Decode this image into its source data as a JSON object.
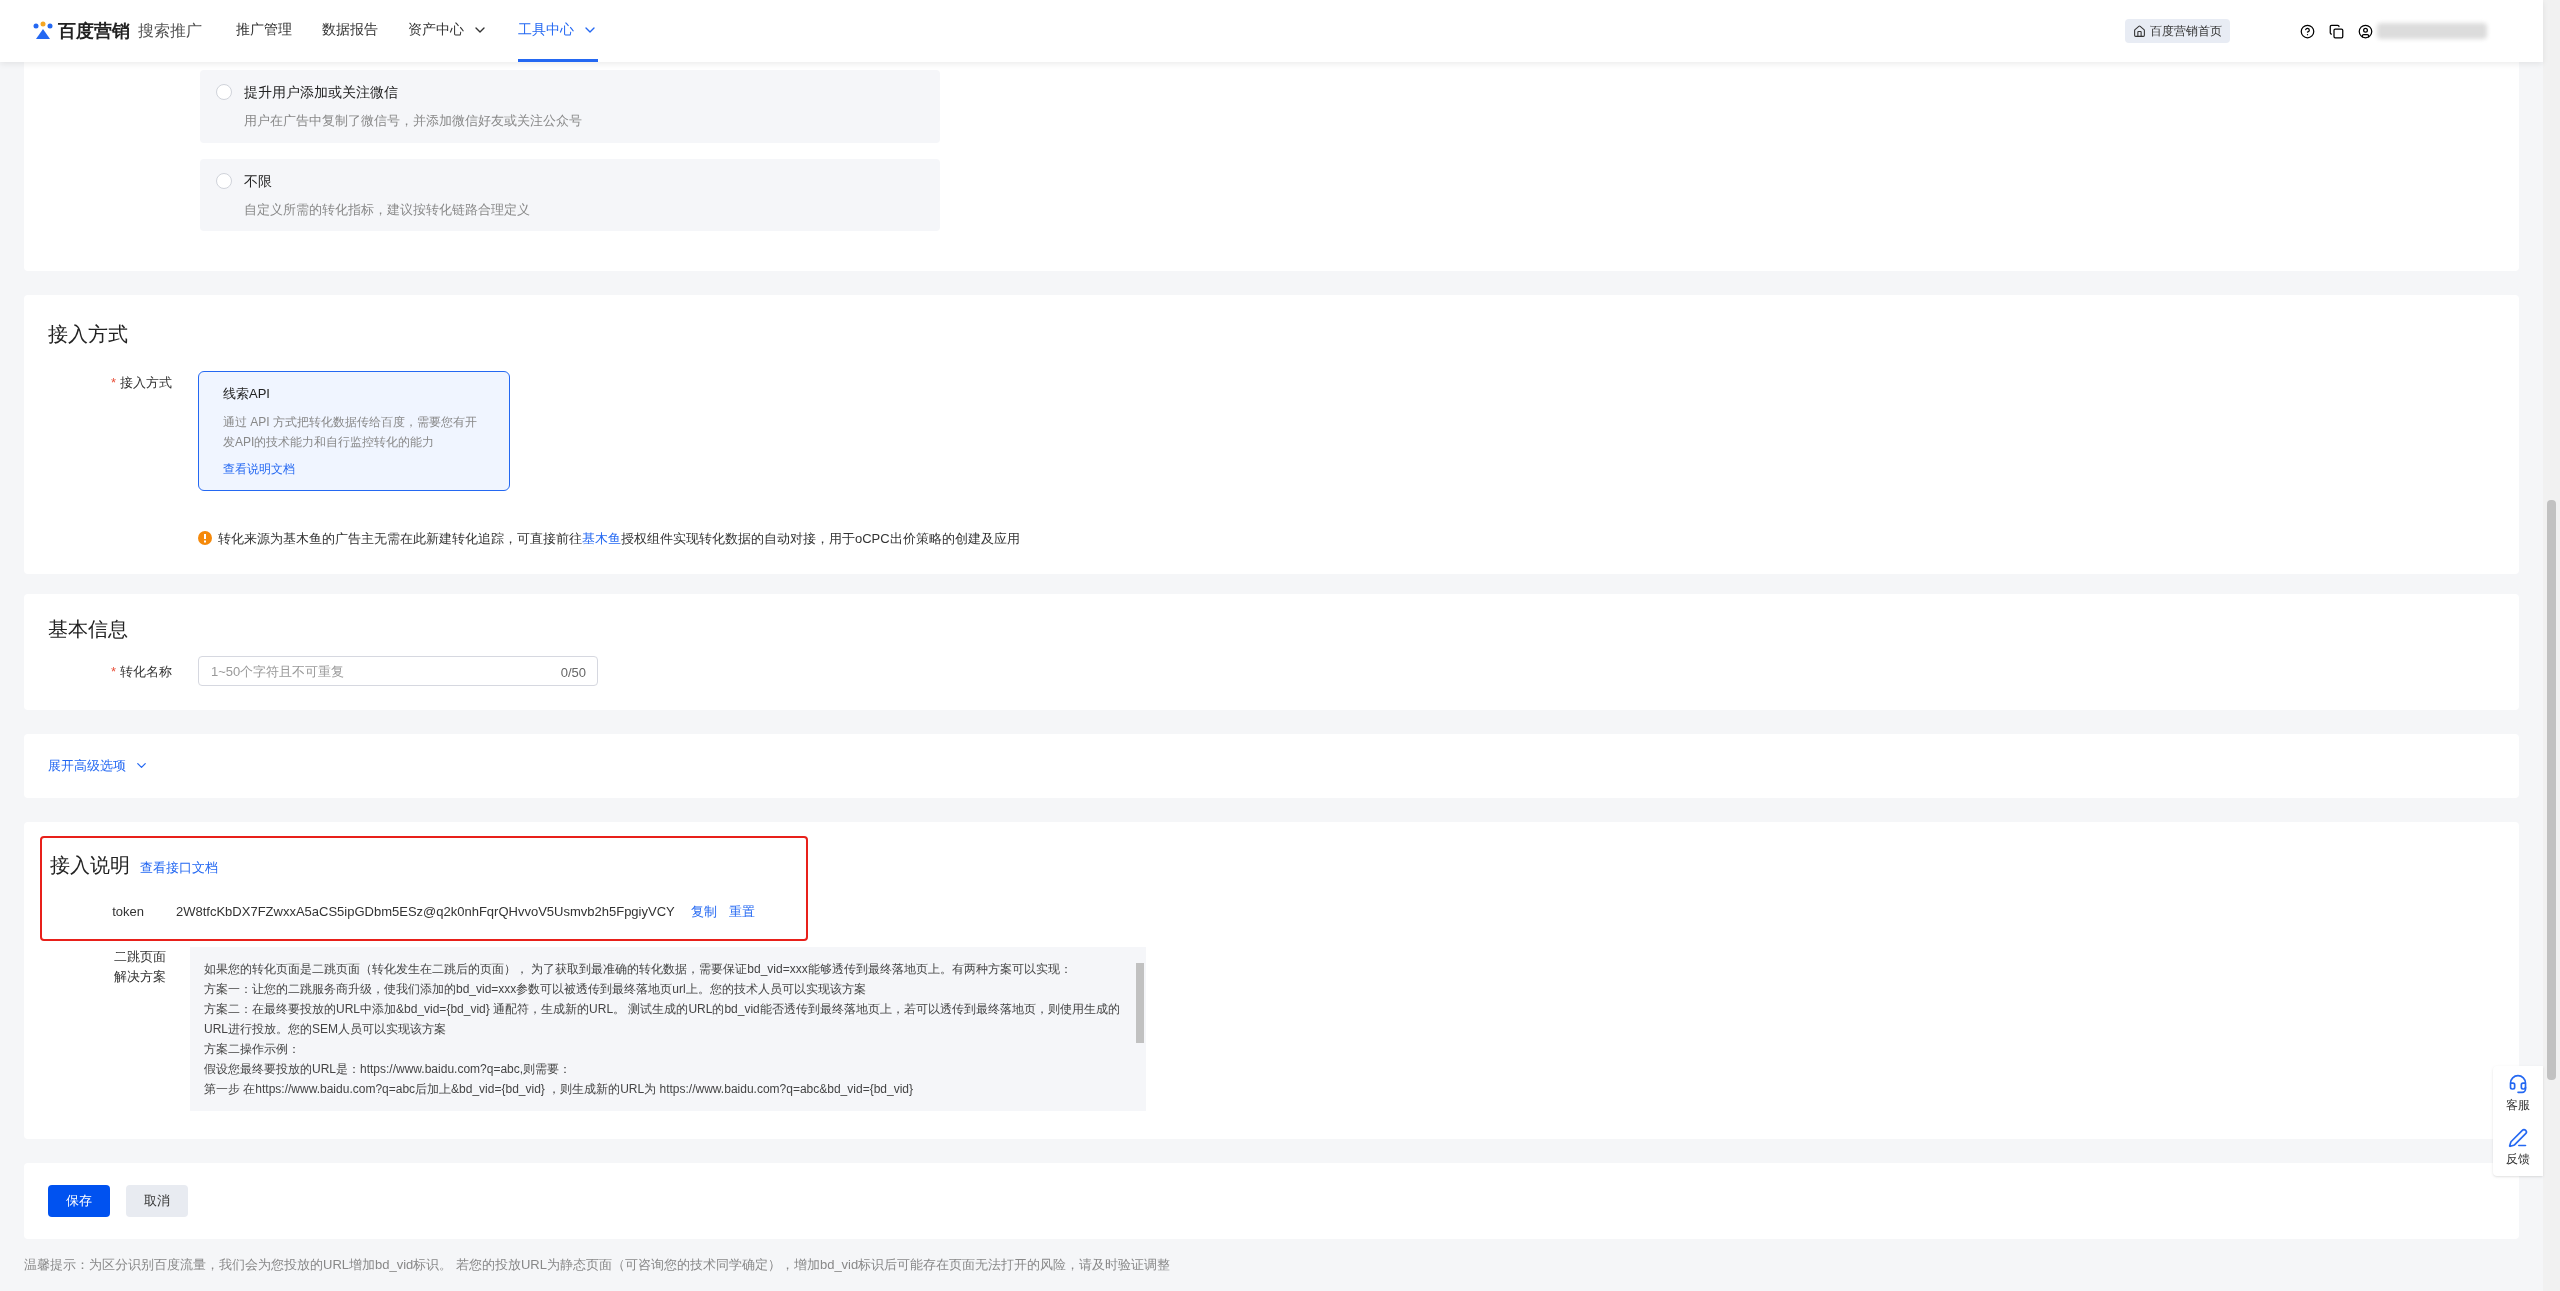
{
  "nav": {
    "logo": "百度营销",
    "product": "搜索推广",
    "items": [
      {
        "label": "推广管理",
        "selected": false,
        "has_menu": false
      },
      {
        "label": "数据报告",
        "selected": false,
        "has_menu": false
      },
      {
        "label": "资产中心",
        "selected": false,
        "has_menu": true
      },
      {
        "label": "工具中心",
        "selected": true,
        "has_menu": true
      }
    ],
    "home_button": "百度营销首页"
  },
  "goal_options": [
    {
      "title": "提升用户添加或关注微信",
      "description": "用户在广告中复制了微信号，并添加微信好友或关注公众号",
      "selected": false
    },
    {
      "title": "不限",
      "description": "自定义所需的转化指标，建议按转化链路合理定义",
      "selected": false
    }
  ],
  "access_section": {
    "title": "接入方式",
    "field": {
      "label": "接入方式",
      "required_mark": "*"
    },
    "option": {
      "title": "线索API",
      "description": "通过 API 方式把转化数据传给百度，需要您有开发API的技术能力和自行监控转化的能力",
      "link": "查看说明文档",
      "selected": true
    },
    "notice": {
      "before": "转化来源为基木鱼的广告主无需在此新建转化追踪，可直接前往",
      "link": "基木鱼",
      "after": "授权组件实现转化数据的自动对接，用于oCPC出价策略的创建及应用"
    }
  },
  "basic_info": {
    "title": "基本信息",
    "field": {
      "label": "转化名称",
      "required_mark": "*"
    },
    "placeholder": "1~50个字符且不可重复",
    "counter": "0/50"
  },
  "advanced_toggle": "展开高级选项",
  "integration": {
    "title": "接入说明",
    "doc_link": "查看接口文档",
    "token_label": "token",
    "token": "2W8tfcKbDX7FZwxxA5aCS5ipGDbm5ESz@q2k0nhFqrQHvvoV5Usmvb2h5FpgiyVCY",
    "copy": "复制",
    "reset": "重置",
    "solution_label": [
      "二跳页面",
      "解决方案"
    ],
    "solution_lines": [
      "如果您的转化页面是二跳页面（转化发生在二跳后的页面），  为了获取到最准确的转化数据，需要保证bd_vid=xxx能够透传到最终落地页上。有两种方案可以实现：",
      "方案一：让您的二跳服务商升级，使我们添加的bd_vid=xxx参数可以被透传到最终落地页url上。您的技术人员可以实现该方案",
      "方案二：在最终要投放的URL中添加&bd_vid={bd_vid} 通配符，生成新的URL。 测试生成的URL的bd_vid能否透传到最终落地页上，若可以透传到最终落地页，则使用生成的URL进行投放。您的SEM人员可以实现该方案",
      "方案二操作示例：",
      "假设您最终要投放的URL是：https://www.baidu.com?q=abc,则需要：",
      "第一步 在https://www.baidu.com?q=abc后加上&bd_vid={bd_vid} ，则生成新的URL为 https://www.baidu.com?q=abc&bd_vid={bd_vid}"
    ]
  },
  "buttons": {
    "save": "保存",
    "cancel": "取消"
  },
  "footer_note": "温馨提示：为区分识别百度流量，我们会为您投放的URL增加bd_vid标识。 若您的投放URL为静态页面（可咨询您的技术同学确定），增加bd_vid标识后可能存在页面无法打开的风险，请及时验证调整",
  "float_buttons": [
    {
      "kind": "service",
      "label": "客服"
    },
    {
      "kind": "feedback",
      "label": "反馈"
    }
  ]
}
